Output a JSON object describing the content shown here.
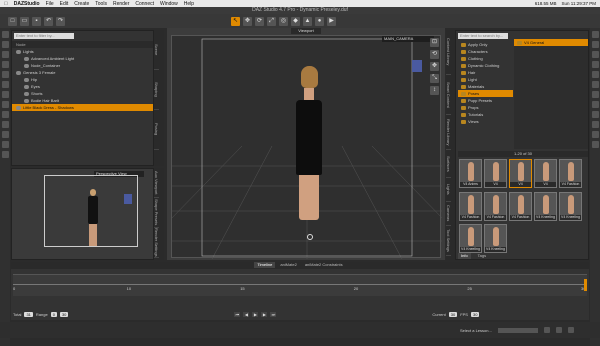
{
  "menubar": {
    "apple": "",
    "app": "DAZStudio",
    "items": [
      "File",
      "Edit",
      "Create",
      "Tools",
      "Render",
      "Connect",
      "Window",
      "Help"
    ],
    "status": [
      "618.55 MB",
      "Sun 11:29:37 PM"
    ]
  },
  "titlebar": {
    "title": "DAZ Studio 4.7 Pro - Dynamic Preseley.duf"
  },
  "scene": {
    "search_placeholder": "Enter text to filter by...",
    "header": "Node",
    "rows": [
      {
        "label": "Lights",
        "sel": false,
        "indent": 0
      },
      {
        "label": "Advanced Ambient Light",
        "sel": false,
        "indent": 1
      },
      {
        "label": "Node_Container",
        "sel": false,
        "indent": 1
      },
      {
        "label": "Genesis 3 Female",
        "sel": false,
        "indent": 0
      },
      {
        "label": "Hip",
        "sel": false,
        "indent": 1
      },
      {
        "label": "Eyes",
        "sel": false,
        "indent": 1
      },
      {
        "label": "Shorts",
        "sel": false,
        "indent": 1
      },
      {
        "label": "Bodie Hair Barlt",
        "sel": false,
        "indent": 1
      },
      {
        "label": "Little Black Dress - Shadows",
        "sel": true,
        "indent": 0
      }
    ],
    "side_tabs": [
      "Scene",
      "Shaping",
      "Posing"
    ]
  },
  "aux": {
    "title": "Perspective View",
    "side_tabs": [
      "Aux Viewport",
      "Shape Presets",
      "Render Settings"
    ]
  },
  "viewport": {
    "tab": "Viewport",
    "camera": "MAIN_CAMERA"
  },
  "content": {
    "search_placeholder": "Enter text to search by...",
    "categories": [
      "Apply Only",
      "Characters",
      "Clothing",
      "Dynamic Clothing",
      "Hair",
      "Light",
      "Materials",
      "Poses",
      "Pupp Presets",
      "Props",
      "Tutorials",
      "Views"
    ],
    "selected_category": "Poses",
    "subfolder": "V4 General",
    "count": "1-20 of 30",
    "thumbs": [
      {
        "label": "V4 Anims Relaxed",
        "sel": false
      },
      {
        "label": "V4 Contrapposto",
        "sel": false
      },
      {
        "label": "V4 Contrapposto 03",
        "sel": true
      },
      {
        "label": "V4 Crouching 01",
        "sel": false
      },
      {
        "label": "V4 Fashion 01",
        "sel": false
      },
      {
        "label": "V4 Fashion 02",
        "sel": false
      },
      {
        "label": "V4 Fashion 03",
        "sel": false
      },
      {
        "label": "V4 Fashion 04",
        "sel": false
      },
      {
        "label": "V4 Kneeling 01",
        "sel": false
      },
      {
        "label": "V4 Kneeling 02",
        "sel": false
      },
      {
        "label": "V4 Kneeling 03",
        "sel": false
      },
      {
        "label": "V4 Kneeling 04",
        "sel": false
      }
    ],
    "bottom_tabs": [
      "Info",
      "Tags"
    ],
    "left_tabs": [
      "Content Library",
      "Smart Content",
      "Render Library"
    ],
    "side_tabs2": [
      "Surfaces",
      "Lights",
      "Cameras",
      "Tool Settings"
    ]
  },
  "timeline": {
    "tabs": [
      "Timeline",
      "aniMate2",
      "aniMate2 Constraints"
    ],
    "ticks": [
      "0",
      "10",
      "15",
      "20",
      "25",
      "30"
    ],
    "total_label": "Total",
    "total": "31",
    "range_label": "Range",
    "range_start": "0",
    "range_end": "30",
    "current_label": "Current",
    "current": "30",
    "fps_label": "FPS",
    "fps": "30"
  },
  "status": {
    "lesson": "Select a Lesson..."
  }
}
